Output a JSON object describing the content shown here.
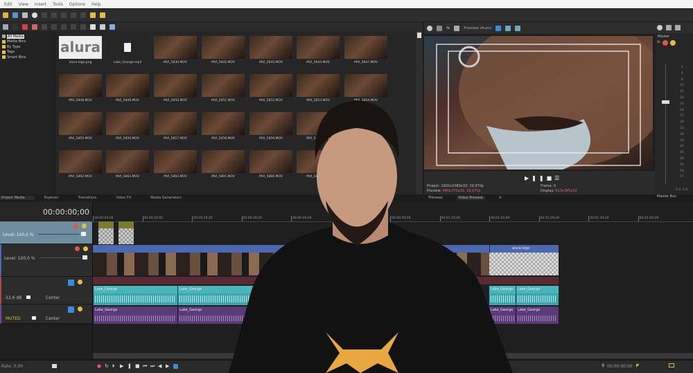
{
  "menu": [
    "Edit",
    "View",
    "Insert",
    "Tools",
    "Options",
    "Help"
  ],
  "media_tree": [
    "All Media",
    "Media Bins",
    "By Type",
    "Tags",
    "Smart Bins"
  ],
  "media_files": [
    "alura-logo.png",
    "Lake_George.mp3",
    "MVI_5830.MOV",
    "MVI_5842.MOV",
    "MVI_5843.MOV",
    "MVI_5844.MOV",
    "MVI_5847.MOV",
    "MVI_5848.MOV",
    "MVI_5849.MOV",
    "MVI_5850.MOV",
    "MVI_5851.MOV",
    "MVI_5852.MOV",
    "MVI_5853.MOV",
    "MVI_5854.MOV",
    "MVI_5855.MOV",
    "MVI_5856.MOV",
    "MVI_5857.MOV",
    "MVI_5858.MOV",
    "MVI_5859.MOV",
    "MVI_5860.MOV",
    "",
    "MVI_5862.MOV",
    "MVI_5863.MOV",
    "MVI_5864.MOV",
    "MVI_5865.MOV",
    "MVI_5866.MOV",
    "MVI_5867.MOV",
    ""
  ],
  "logo_text": "alura",
  "left_tabs": [
    "Project Media",
    "Explorer",
    "Transitions",
    "Video FX",
    "Media Generators"
  ],
  "preview": {
    "mode": "Preview (Auto)",
    "project_label": "Project:",
    "project": "1920x1080x32; 29,970p",
    "preview_label": "Preview:",
    "preview": "480x270x32; 29,970p",
    "frame_label": "Frame:",
    "frame": "0",
    "display_label": "Display:",
    "display": "613x345x32",
    "tabs": [
      "Trimmer",
      "Video Preview"
    ]
  },
  "master": {
    "label": "Master",
    "scale": [
      "3",
      "6",
      "9",
      "12",
      "15",
      "18",
      "21",
      "24",
      "27",
      "30",
      "33",
      "36",
      "39",
      "42",
      "45",
      "48",
      "51",
      "54",
      "57"
    ],
    "values": [
      "0.0",
      "0.0"
    ],
    "tab": "Master Bus"
  },
  "timeline": {
    "timecode": "00:00:00;00",
    "ruler": [
      "00:00:00;00",
      "00:00:10;00",
      "00:00:19;29",
      "00:00:29;29",
      "00:00:39;29",
      "00:00:49;29",
      "00:00:59;28",
      "00:01:10;00",
      "00:01:20;00",
      "00:01:29;29",
      "00:01:39;29",
      "00:01:49;29"
    ],
    "tracks": [
      {
        "level": "Level: 100,0 %"
      },
      {
        "level": "Level: 100,0 %"
      },
      {
        "volume": "-12,6 dB",
        "pan": "Center"
      },
      {
        "volume": "MUTED",
        "pan": "Center"
      }
    ],
    "audio_clip": "Lake_George",
    "video_clip": "alura-logo"
  },
  "bottom": {
    "rate": "Rate: 0,00",
    "time": "00:00:00;00"
  },
  "colors": {
    "video_track": "#4b69b0",
    "audio1": "#3aa6ad",
    "audio2": "#5a3a78",
    "muted": "#e0c020",
    "selected_track": "#6e8ea0"
  }
}
